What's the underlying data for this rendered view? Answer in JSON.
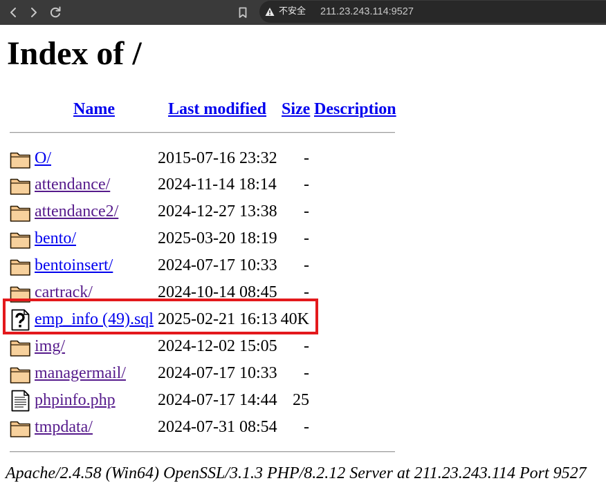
{
  "browser": {
    "security_label": "不安全",
    "url": "211.23.243.114:9527",
    "icons": [
      "back-icon",
      "forward-icon",
      "reload-icon",
      "bookmark-icon",
      "warning-icon"
    ]
  },
  "page": {
    "title": "Index of /"
  },
  "table": {
    "headers": {
      "name": "Name",
      "last_modified": "Last modified",
      "size": "Size",
      "description": "Description"
    },
    "rows": [
      {
        "name": "O/",
        "modified": "2015-07-16 23:32",
        "size": "-",
        "icon": "folder-icon",
        "visited": false
      },
      {
        "name": "attendance/",
        "modified": "2024-11-14 18:14",
        "size": "-",
        "icon": "folder-icon",
        "visited": true
      },
      {
        "name": "attendance2/",
        "modified": "2024-12-27 13:38",
        "size": "-",
        "icon": "folder-icon",
        "visited": true
      },
      {
        "name": "bento/",
        "modified": "2025-03-20 18:19",
        "size": "-",
        "icon": "folder-icon",
        "visited": false
      },
      {
        "name": "bentoinsert/",
        "modified": "2024-07-17 10:33",
        "size": "-",
        "icon": "folder-icon",
        "visited": false
      },
      {
        "name": "cartrack/",
        "modified": "2024-10-14 08:45",
        "size": "-",
        "icon": "folder-icon",
        "visited": true
      },
      {
        "name": "emp_info (49).sql",
        "modified": "2025-02-21 16:13",
        "size": "40K",
        "icon": "unknown-file-icon",
        "visited": false,
        "highlighted": true
      },
      {
        "name": "img/",
        "modified": "2024-12-02 15:05",
        "size": "-",
        "icon": "folder-icon",
        "visited": true
      },
      {
        "name": "managermail/",
        "modified": "2024-07-17 10:33",
        "size": "-",
        "icon": "folder-icon",
        "visited": true
      },
      {
        "name": "phpinfo.php",
        "modified": "2024-07-17 14:44",
        "size": "25",
        "icon": "text-file-icon",
        "visited": true
      },
      {
        "name": "tmpdata/",
        "modified": "2024-07-31 08:54",
        "size": "-",
        "icon": "folder-icon",
        "visited": true
      }
    ]
  },
  "footer": "Apache/2.4.58 (Win64) OpenSSL/3.1.3 PHP/8.2.12 Server at 211.23.243.114 Port 9527",
  "colors": {
    "link": "#0000EE",
    "link_visited": "#551A8B",
    "highlight_box": "#E3191C",
    "folder": "#F6C78D"
  }
}
